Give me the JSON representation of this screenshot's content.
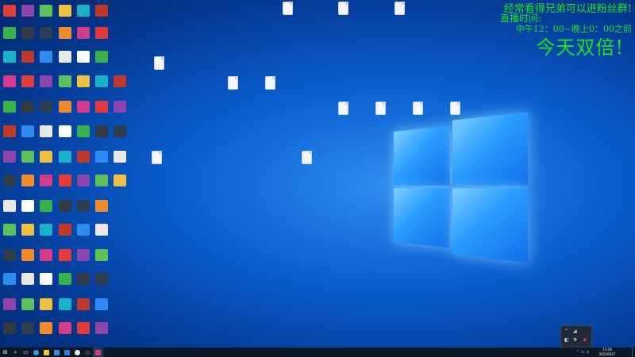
{
  "overlay": {
    "line1": "经常看得兄弟可以进粉丝群!",
    "line2": "直播时间:",
    "line3": "中午12：00~晚上0：00之前",
    "line4": "今天双倍!"
  },
  "taskbar": {
    "time": "13:28",
    "date": "2022/6/27",
    "start_icon": "windows-logo-icon",
    "search_icon": "search-icon",
    "taskview_icon": "task-view-icon"
  },
  "tray_popup": {
    "icons": [
      "network-icon",
      "volume-icon",
      "location-icon",
      "security-icon"
    ]
  },
  "colors": {
    "overlay_text": "#20e020",
    "taskbar": "#0c1826"
  }
}
